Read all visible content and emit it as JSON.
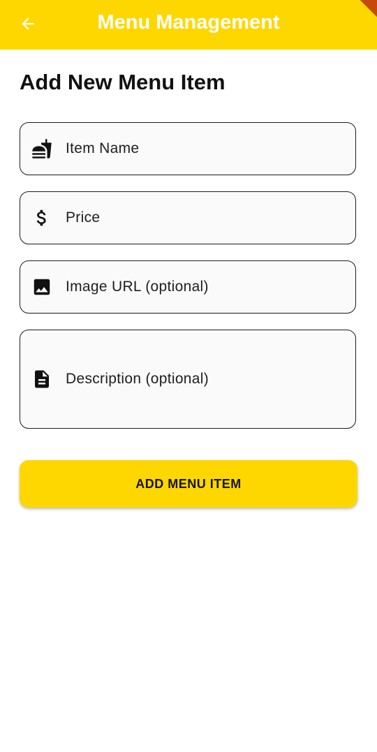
{
  "app_bar": {
    "title": "Menu Management",
    "back_icon": "arrow-left-icon",
    "background": "#FFD700",
    "title_color": "#FFFFFF"
  },
  "form": {
    "heading": "Add New Menu Item",
    "fields": [
      {
        "label": "Item Name",
        "icon": "fastfood-icon"
      },
      {
        "label": "Price",
        "icon": "dollar-icon"
      },
      {
        "label": "Image URL (optional)",
        "icon": "image-icon"
      },
      {
        "label": "Description (optional)",
        "icon": "description-icon"
      }
    ],
    "submit_label": "ADD MENU ITEM",
    "accent": "#FFD700"
  }
}
